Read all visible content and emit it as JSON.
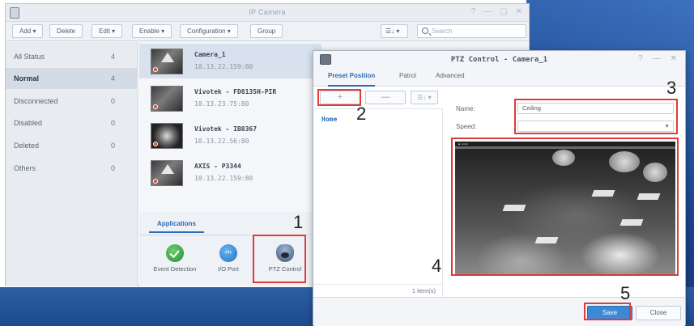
{
  "colors": {
    "accent": "#2a6db5",
    "annotation_red": "#e03a3a",
    "save_blue": "#3d89d8",
    "status_red": "#d64a3a"
  },
  "main_window": {
    "title": "IP Camera",
    "app_icon": "ip-camera-app-icon",
    "window_controls": [
      "?",
      "—",
      "▢",
      "✕"
    ],
    "toolbar": {
      "add_label": "Add ▾",
      "delete_label": "Delete",
      "edit_label": "Edit ▾",
      "enable_label": "Enable ▾",
      "configuration_label": "Configuration ▾",
      "group_label": "Group",
      "view_label": "☰↓ ▾",
      "search_placeholder": "Search"
    },
    "sidebar": {
      "items": [
        {
          "label": "All Status",
          "count": "4"
        },
        {
          "label": "Normal",
          "count": "4"
        },
        {
          "label": "Disconnected",
          "count": "0"
        },
        {
          "label": "Disabled",
          "count": "0"
        },
        {
          "label": "Deleted",
          "count": "0"
        },
        {
          "label": "Others",
          "count": "0"
        }
      ]
    },
    "cameras": [
      {
        "name": "Camera_1",
        "ip": "10.13.22.159:80"
      },
      {
        "name": "Vivotek - FD8135H-PIR",
        "ip": "10.13.23.75:80"
      },
      {
        "name": "Vivotek - IB8367",
        "ip": "10.13.22.56:80"
      },
      {
        "name": "AXIS - P3344",
        "ip": "10.13.22.159:80"
      }
    ],
    "applications": {
      "tab_label": "Applications",
      "items": [
        {
          "label": "Event Detection",
          "icon": "event-detection-icon"
        },
        {
          "label": "I/O Port",
          "icon": "io-port-icon"
        },
        {
          "label": "PTZ Control",
          "icon": "ptz-control-icon"
        }
      ]
    }
  },
  "ptz_dialog": {
    "title": "PTZ Control - Camera_1",
    "window_controls": [
      "?",
      "—",
      "✕"
    ],
    "tabs": [
      "Preset Position",
      "Patrol",
      "Advanced"
    ],
    "toolbar": {
      "add_label": "+",
      "remove_label": "—",
      "view_label": "☰↓ ▾"
    },
    "presets": [
      "Home"
    ],
    "item_count": "1 item(s)",
    "form": {
      "name_label": "Name:",
      "name_value": "Ceiling",
      "speed_label": "Speed:",
      "speed_value": ""
    },
    "live_view_overlay": "▪ ▫▫▫▫",
    "save_label": "Save",
    "close_label": "Close"
  },
  "annotations": {
    "step_1": "1",
    "step_2": "2",
    "step_3": "3",
    "step_4": "4",
    "step_5": "5"
  }
}
